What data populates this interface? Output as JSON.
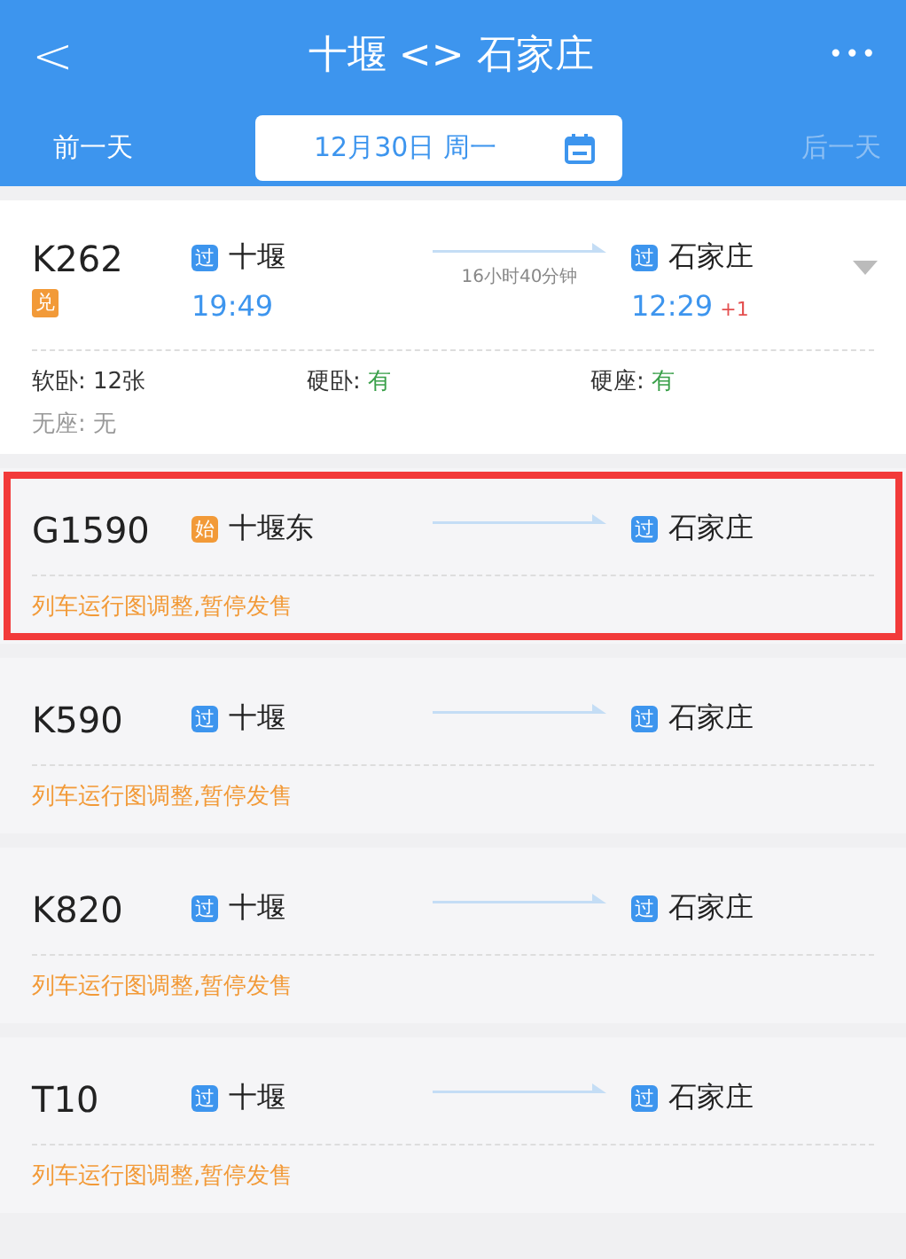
{
  "header": {
    "back": "<",
    "title": "十堰 <> 石家庄",
    "more": "•••"
  },
  "date_bar": {
    "prev": {
      "label": "前一天",
      "disabled": false
    },
    "date": "12月30日 周一",
    "next": {
      "label": "后一天",
      "disabled": true
    }
  },
  "trains": [
    {
      "number": "K262",
      "tag": {
        "text": "兑",
        "color": "#f29a38"
      },
      "from": {
        "badge": {
          "text": "过",
          "color": "#3d95ee"
        },
        "station": "十堰",
        "time": "19:49"
      },
      "duration": "16小时40分钟",
      "to": {
        "badge": {
          "text": "过",
          "color": "#3d95ee"
        },
        "station": "石家庄",
        "time": "12:29",
        "day_offset": "+1"
      },
      "expandable": true,
      "highlighted": false,
      "seats": [
        {
          "label": "软卧:",
          "value": "12张",
          "color": "#333333",
          "disabled": false
        },
        {
          "label": "硬卧:",
          "value": "有",
          "color": "#3aa04a",
          "disabled": false
        },
        {
          "label": "硬座:",
          "value": "有",
          "color": "#3aa04a",
          "disabled": false
        },
        {
          "label": "无座:",
          "value": "无",
          "color": "#999999",
          "disabled": true
        }
      ]
    },
    {
      "number": "G1590",
      "from": {
        "badge": {
          "text": "始",
          "color": "#f29a38"
        },
        "station": "十堰东"
      },
      "to": {
        "badge": {
          "text": "过",
          "color": "#3d95ee"
        },
        "station": "石家庄"
      },
      "notice": "列车运行图调整,暂停发售",
      "expandable": false,
      "highlighted": true
    },
    {
      "number": "K590",
      "from": {
        "badge": {
          "text": "过",
          "color": "#3d95ee"
        },
        "station": "十堰"
      },
      "to": {
        "badge": {
          "text": "过",
          "color": "#3d95ee"
        },
        "station": "石家庄"
      },
      "notice": "列车运行图调整,暂停发售",
      "expandable": false,
      "highlighted": false
    },
    {
      "number": "K820",
      "from": {
        "badge": {
          "text": "过",
          "color": "#3d95ee"
        },
        "station": "十堰"
      },
      "to": {
        "badge": {
          "text": "过",
          "color": "#3d95ee"
        },
        "station": "石家庄"
      },
      "notice": "列车运行图调整,暂停发售",
      "expandable": false,
      "highlighted": false
    },
    {
      "number": "T10",
      "from": {
        "badge": {
          "text": "过",
          "color": "#3d95ee"
        },
        "station": "十堰"
      },
      "to": {
        "badge": {
          "text": "过",
          "color": "#3d95ee"
        },
        "station": "石家庄"
      },
      "notice": "列车运行图调整,暂停发售",
      "expandable": false,
      "highlighted": false
    }
  ]
}
